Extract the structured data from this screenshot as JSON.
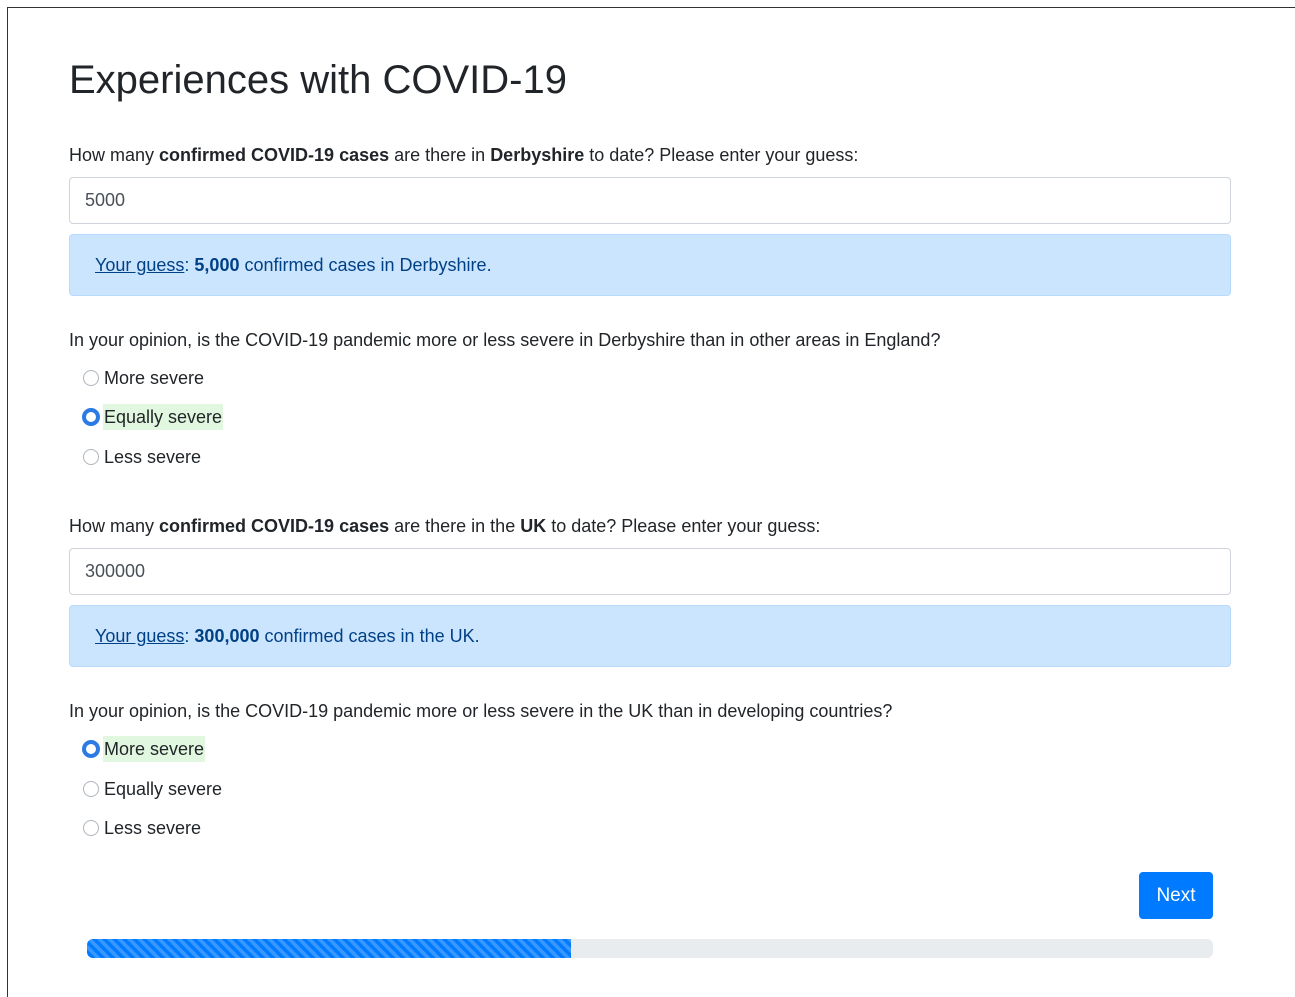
{
  "page": {
    "title": "Experiences with COVID-19"
  },
  "questions": [
    {
      "label_parts": [
        "How many ",
        "confirmed COVID-19 cases",
        " are there in ",
        "Derbyshire",
        " to date? Please enter your guess:"
      ],
      "input_value": "5000",
      "feedback": {
        "link_text": "Your guess",
        "separator": ": ",
        "value": "5,000",
        "suffix": " confirmed cases in Derbyshire."
      }
    },
    {
      "label": "In your opinion, is the COVID-19 pandemic more or less severe in Derbyshire than in other areas in England?",
      "options": [
        "More severe",
        "Equally severe",
        "Less severe"
      ],
      "selected": "Equally severe"
    },
    {
      "label_parts": [
        "How many ",
        "confirmed COVID-19 cases",
        " are there in the ",
        "UK",
        " to date? Please enter your guess:"
      ],
      "input_value": "300000",
      "feedback": {
        "link_text": "Your guess",
        "separator": ": ",
        "value": "300,000",
        "suffix": " confirmed cases in the UK."
      }
    },
    {
      "label": "In your opinion, is the COVID-19 pandemic more or less severe in the UK than in developing countries?",
      "options": [
        "More severe",
        "Equally severe",
        "Less severe"
      ],
      "selected": "More severe"
    }
  ],
  "navigation": {
    "next_label": "Next"
  },
  "progress": {
    "fraction": 0.43,
    "color": "#007bff"
  },
  "colors": {
    "accent": "#007bff",
    "alert_bg": "#cce5ff",
    "alert_text": "#004085",
    "selected_highlight": "#e2f7df"
  }
}
